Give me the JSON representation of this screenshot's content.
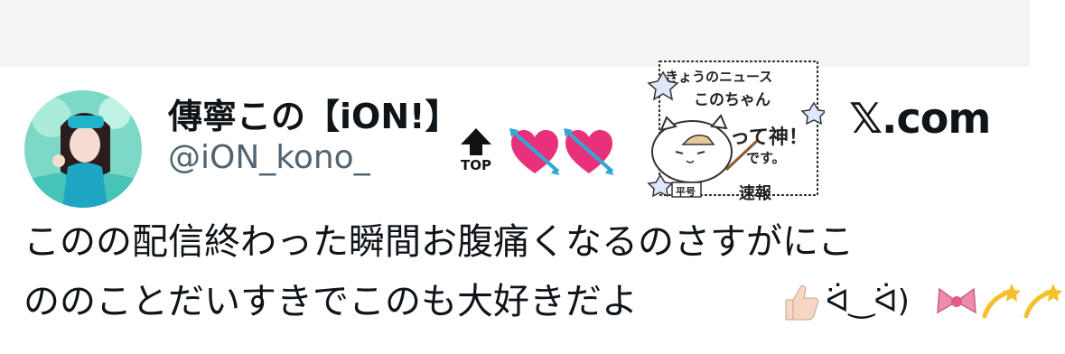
{
  "tweet": {
    "display_name": "傳寧この【iON!】",
    "handle": "@iON_kono_",
    "line1": "このの配信終わった瞬間お腹痛くなるのさすがにこ",
    "line2": "ののことだいすきでこのも大好きだよ",
    "kaomoji": "ᐛ‿ᐛ)"
  },
  "decorations": {
    "top_label": "TOP",
    "sticker": {
      "line1": "きょうのニュース",
      "line2": "このちゃん",
      "line3": "って神！",
      "line4": "です。",
      "stamp": "平号",
      "stamp2": "速報"
    }
  },
  "brand": {
    "site": "𝕏.com"
  },
  "icons": [
    "avatar",
    "up-arrow-icon",
    "heart-with-arrow-icon",
    "thumbs-up-icon",
    "ribbon-icon",
    "dizzy-icon"
  ],
  "colors": {
    "text": "#0f1419",
    "secondary": "#536471",
    "heart": "#e8317a",
    "arrow": "#2fa8d8"
  }
}
